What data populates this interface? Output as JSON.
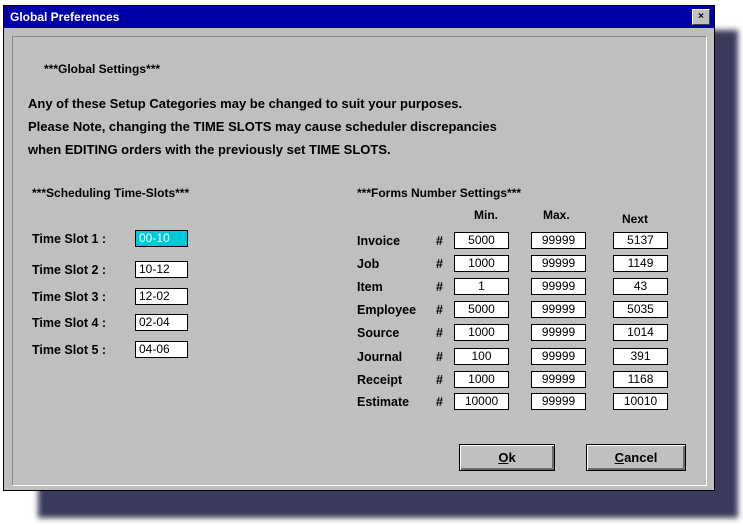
{
  "window": {
    "title": "Global Preferences",
    "close_glyph": "×"
  },
  "header": {
    "section_title": "***Global Settings***",
    "line1": "Any of these Setup Categories may be changed to suit your purposes.",
    "line2": "Please Note, changing the TIME SLOTS may cause scheduler discrepancies",
    "line3": "when EDITING orders with the previously set TIME SLOTS."
  },
  "time_slots": {
    "title": "***Scheduling Time-Slots***",
    "items": [
      {
        "label": "Time Slot 1 :",
        "value": "00-10"
      },
      {
        "label": "Time Slot 2 :",
        "value": "10-12"
      },
      {
        "label": "Time Slot 3 :",
        "value": "12-02"
      },
      {
        "label": "Time Slot 4 :",
        "value": "02-04"
      },
      {
        "label": "Time Slot 5 :",
        "value": "04-06"
      }
    ]
  },
  "forms": {
    "title": "***Forms Number Settings***",
    "columns": {
      "min": "Min.",
      "max": "Max.",
      "next": "Next"
    },
    "hash": "#",
    "rows": [
      {
        "label": "Invoice",
        "min": "5000",
        "max": "99999",
        "next": "5137"
      },
      {
        "label": "Job",
        "min": "1000",
        "max": "99999",
        "next": "1149"
      },
      {
        "label": "Item",
        "min": "1",
        "max": "99999",
        "next": "43"
      },
      {
        "label": "Employee",
        "min": "5000",
        "max": "99999",
        "next": "5035"
      },
      {
        "label": "Source",
        "min": "1000",
        "max": "99999",
        "next": "1014"
      },
      {
        "label": "Journal",
        "min": "100",
        "max": "99999",
        "next": "391"
      },
      {
        "label": "Receipt",
        "min": "1000",
        "max": "99999",
        "next": "1168"
      },
      {
        "label": "Estimate",
        "min": "10000",
        "max": "99999",
        "next": "10010"
      }
    ]
  },
  "buttons": {
    "ok_mnemonic": "O",
    "ok_rest": "k",
    "cancel_mnemonic": "C",
    "cancel_rest": "ancel"
  },
  "colors": {
    "titlebar": "#0000a8",
    "dialog": "#bfbfbf",
    "selection": "#00c8d8"
  }
}
